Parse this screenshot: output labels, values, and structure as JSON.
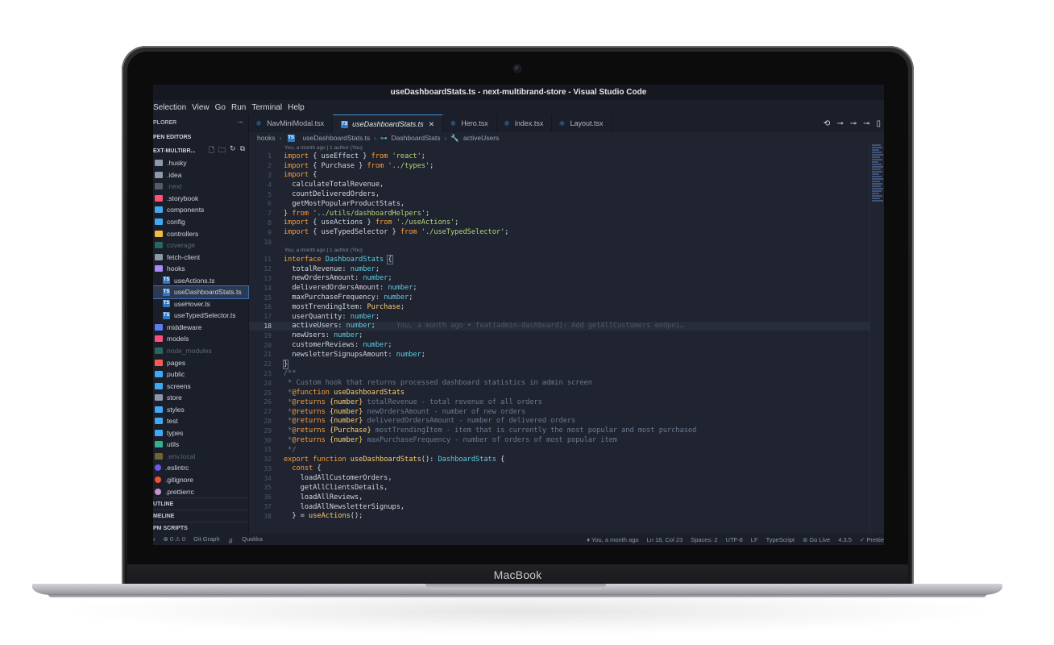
{
  "window": {
    "title": "useDashboardStats.ts - next-multibrand-store - Visual Studio Code"
  },
  "device": {
    "brand": "MacBook"
  },
  "menu": [
    "Selection",
    "View",
    "Go",
    "Run",
    "Terminal",
    "Help"
  ],
  "sidebar": {
    "header": "PLORER",
    "header_more": "···",
    "open_editors": "PEN EDITORS",
    "project": "EXT-MULTIBR...",
    "tree": [
      {
        "label": ".husky",
        "kind": "folder",
        "color": "#8d98ab"
      },
      {
        "label": ".idea",
        "kind": "folder",
        "color": "#8d98ab"
      },
      {
        "label": ".next",
        "kind": "folder",
        "color": "#8d98ab",
        "dim": true
      },
      {
        "label": ".storybook",
        "kind": "folder",
        "color": "#ff4f7a"
      },
      {
        "label": "components",
        "kind": "folder",
        "color": "#3fa9f5"
      },
      {
        "label": "config",
        "kind": "folder",
        "color": "#3fa9f5"
      },
      {
        "label": "controllers",
        "kind": "folder",
        "color": "#f5b93f"
      },
      {
        "label": "coverage",
        "kind": "folder",
        "color": "#36b08f",
        "dim": true
      },
      {
        "label": "fetch-client",
        "kind": "folder",
        "color": "#8d98ab"
      },
      {
        "label": "hooks",
        "kind": "folder",
        "color": "#a78bfa"
      },
      {
        "label": "useActions.ts",
        "kind": "ts"
      },
      {
        "label": "useDashboardStats.ts",
        "kind": "ts",
        "selected": true
      },
      {
        "label": "useHover.ts",
        "kind": "ts"
      },
      {
        "label": "useTypedSelector.ts",
        "kind": "ts"
      },
      {
        "label": "middleware",
        "kind": "folder",
        "color": "#5b7cf5"
      },
      {
        "label": "models",
        "kind": "folder",
        "color": "#ff4f7a"
      },
      {
        "label": "node_modules",
        "kind": "folder",
        "color": "#36b08f",
        "dim": true
      },
      {
        "label": "pages",
        "kind": "folder",
        "color": "#ff5a4e"
      },
      {
        "label": "public",
        "kind": "folder",
        "color": "#3fa9f5"
      },
      {
        "label": "screens",
        "kind": "folder",
        "color": "#3fa9f5"
      },
      {
        "label": "store",
        "kind": "folder",
        "color": "#8d98ab"
      },
      {
        "label": "styles",
        "kind": "folder",
        "color": "#3fa9f5"
      },
      {
        "label": "test",
        "kind": "folder",
        "color": "#3fa9f5"
      },
      {
        "label": "types",
        "kind": "folder",
        "color": "#3fa9f5"
      },
      {
        "label": "utils",
        "kind": "folder",
        "color": "#36b08f"
      },
      {
        "label": ".env.local",
        "kind": "env",
        "dim": true
      },
      {
        "label": ".eslintrc",
        "kind": "eslint"
      },
      {
        "label": ".gitignore",
        "kind": "git"
      },
      {
        "label": ".prettierrc",
        "kind": "prettier"
      }
    ],
    "outline": "UTLINE",
    "timeline": "MELINE",
    "npm_scripts": "PM SCRIPTS"
  },
  "tabs": [
    {
      "label": "NavMiniModal.tsx",
      "active": false
    },
    {
      "label": "useDashboardStats.ts",
      "active": true
    },
    {
      "label": "Hero.tsx",
      "active": false
    },
    {
      "label": "index.tsx",
      "active": false
    },
    {
      "label": "Layout.tsx",
      "active": false
    }
  ],
  "breadcrumb": [
    "hooks",
    "useDashboardStats.ts",
    "DashboardStats",
    "activeUsers"
  ],
  "editor": {
    "blame_1": "You, a month ago | 1 author (You)",
    "blame_2": "You, a month ago | 1 author (You)",
    "inline_blame": "You, a month ago • feat(admin-dashboard): Add getAllCustomers endpoi…",
    "current_line": 18
  },
  "status": {
    "left": [
      "⊗ 0 ⚠ 0",
      "Git Graph",
      "Quokka"
    ],
    "right": [
      "You, a month ago",
      "Ln 18, Col 23",
      "Spaces: 2",
      "UTF-8",
      "LF",
      "TypeScript",
      "Go Live",
      "4.3.5",
      "Prettie"
    ]
  }
}
